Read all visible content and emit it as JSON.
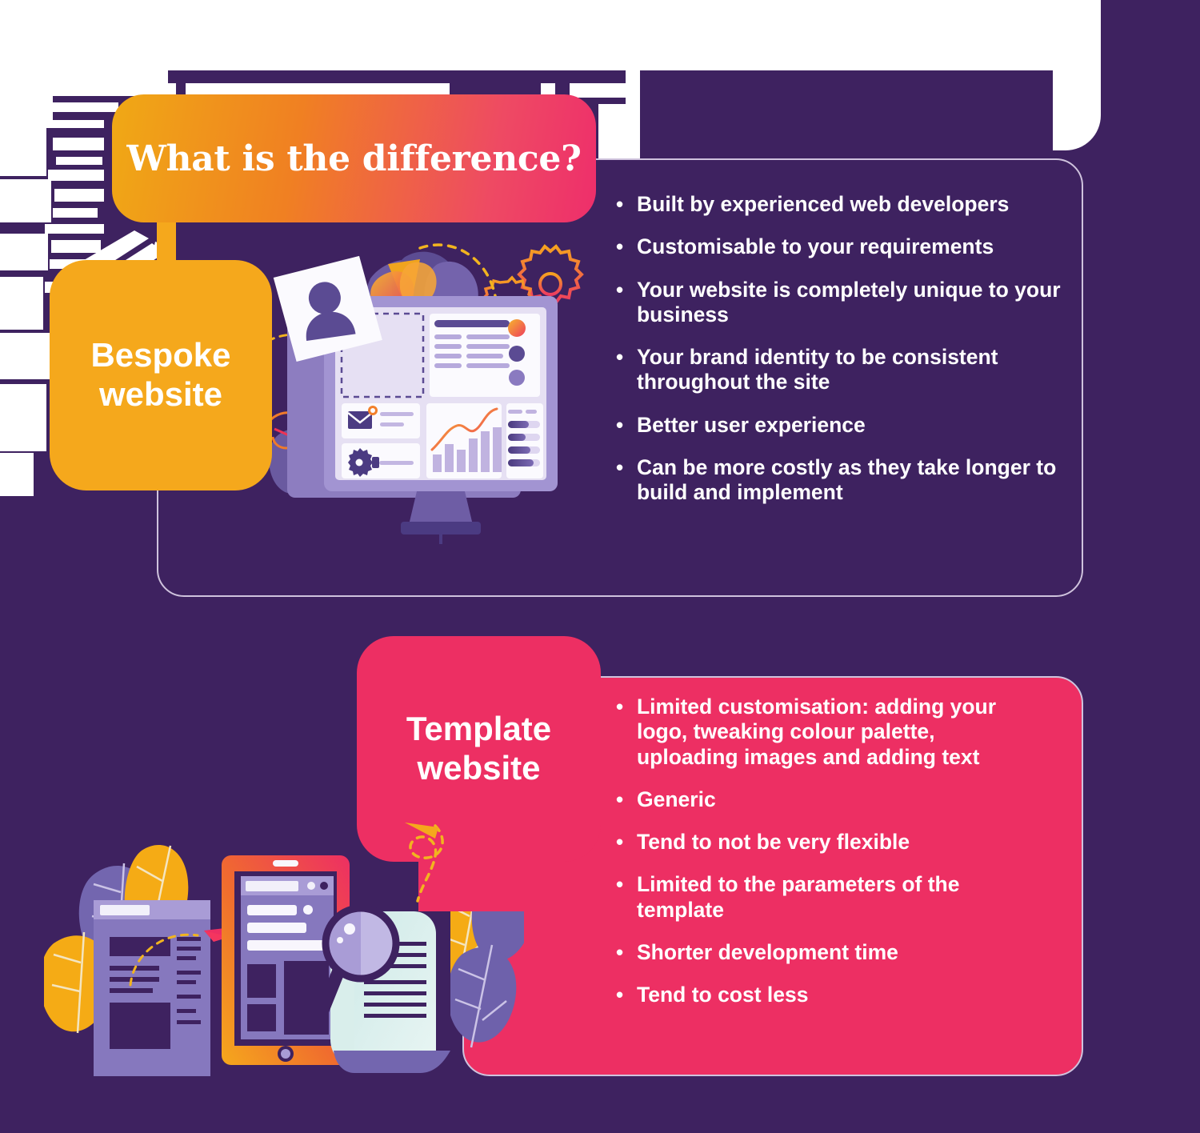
{
  "infographic": {
    "title": "What is the difference?",
    "sections": [
      {
        "id": "bespoke",
        "label": "Bespoke\nwebsite",
        "label_line1": "Bespoke",
        "label_line2": "website",
        "accent_color": "#F5A81C",
        "panel_color": "#3E2260",
        "bullets": [
          "Built by experienced web developers",
          "Customisable to your requirements",
          "Your website is completely unique to your business",
          "Your brand identity to be consistent throughout the site",
          "Better user experience",
          "Can be more costly as they take longer to build and implement"
        ]
      },
      {
        "id": "template",
        "label": "Template\nwebsite",
        "label_line1": "Template",
        "label_line2": "website",
        "accent_color": "#ED2F63",
        "panel_color": "#ED2F63",
        "bullets": [
          "Limited customisation: adding your logo, tweaking colour palette, uploading images and adding text",
          "Generic",
          "Tend to not be very flexible",
          "Limited to the parameters of the template",
          "Shorter development time",
          "Tend to cost less"
        ]
      }
    ],
    "bullet_marker": "•",
    "colors": {
      "background_purple": "#3E2260",
      "gold": "#F5A81C",
      "pink": "#ED2F63",
      "orange": "#F08022",
      "white": "#FFFFFF",
      "lavender": "#7D6BB0",
      "light_lavender": "#CFC6E4",
      "title_gradient_from": "#F0A915",
      "title_gradient_to": "#EE2E6B"
    },
    "illustrations": {
      "bespoke": {
        "name": "desktop-monitor-dashboard",
        "elements": [
          "monitor-screen",
          "avatar-photo-card",
          "gear-icons",
          "dashed-arc",
          "bar-chart-widget",
          "envelope-widget",
          "settings-slider-widget",
          "progress-bars-widget"
        ]
      },
      "template": {
        "name": "tablet-document-magnifier",
        "elements": [
          "tablet-device",
          "browser-window",
          "document-page",
          "magnifying-glass",
          "leaf-decorations",
          "paper-plane",
          "dashed-squiggle"
        ]
      }
    }
  }
}
